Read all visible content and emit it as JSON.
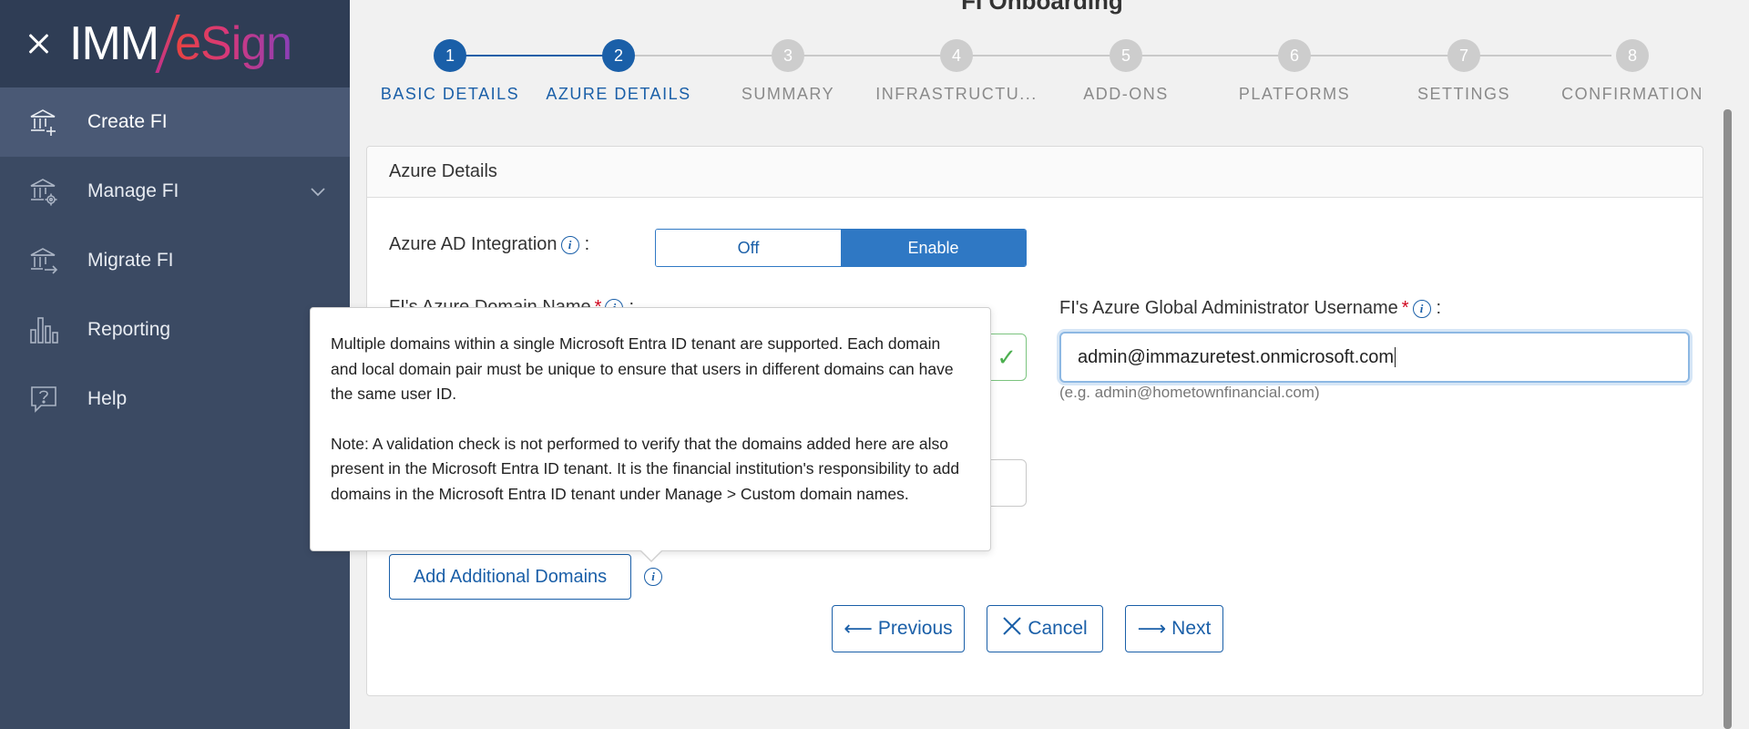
{
  "brand": {
    "logo_part1": "IMM",
    "logo_part2": "eSign"
  },
  "sidebar": {
    "items": [
      {
        "label": "Create FI",
        "icon": "bank-plus-icon",
        "active": true
      },
      {
        "label": "Manage FI",
        "icon": "bank-gear-icon",
        "expandable": true
      },
      {
        "label": "Migrate FI",
        "icon": "bank-arrow-icon"
      },
      {
        "label": "Reporting",
        "icon": "bar-chart-icon"
      },
      {
        "label": "Help",
        "icon": "question-bubble-icon"
      }
    ]
  },
  "page": {
    "title": "FI Onboarding"
  },
  "stepper": {
    "steps": [
      {
        "number": "1",
        "label": "BASIC DETAILS",
        "state": "complete"
      },
      {
        "number": "2",
        "label": "AZURE DETAILS",
        "state": "current"
      },
      {
        "number": "3",
        "label": "SUMMARY",
        "state": "pending"
      },
      {
        "number": "4",
        "label": "INFRASTRUCTU...",
        "state": "pending"
      },
      {
        "number": "5",
        "label": "ADD-ONS",
        "state": "pending"
      },
      {
        "number": "6",
        "label": "PLATFORMS",
        "state": "pending"
      },
      {
        "number": "7",
        "label": "SETTINGS",
        "state": "pending"
      },
      {
        "number": "8",
        "label": "CONFIRMATION",
        "state": "pending"
      }
    ]
  },
  "card": {
    "title": "Azure Details",
    "azure_ad": {
      "label": "Azure AD Integration",
      "colon": ":",
      "off_label": "Off",
      "on_label": "Enable",
      "selected": "Enable"
    },
    "domain_name": {
      "label": "FI's Azure Domain Name",
      "required_mark": "*",
      "colon": ":"
    },
    "admin_username": {
      "label": "FI's Azure Global Administrator Username",
      "required_mark": "*",
      "colon": ":",
      "value": "admin@immazuretest.onmicrosoft.com",
      "hint": "(e.g. admin@hometownfinancial.com)"
    },
    "add_domains_label": "Add Additional Domains",
    "tooltip": {
      "paragraph1": "Multiple domains within a single Microsoft Entra ID tenant are supported. Each domain and local domain pair must be unique to ensure that users in different domains can have the same user ID.",
      "paragraph2": "Note: A validation check is not performed to verify that the domains added here are also present in the Microsoft Entra ID tenant. It is the financial institution's responsibility to add domains in the Microsoft Entra ID tenant under Manage > Custom domain names."
    },
    "buttons": {
      "previous": "Previous",
      "cancel": "Cancel",
      "next": "Next"
    }
  },
  "colors": {
    "sidebar_bg": "#3b4a63",
    "sidebar_active": "#4a5975",
    "primary": "#1a5fa8",
    "toggle_active": "#2f78c4",
    "required": "#d0021b"
  }
}
